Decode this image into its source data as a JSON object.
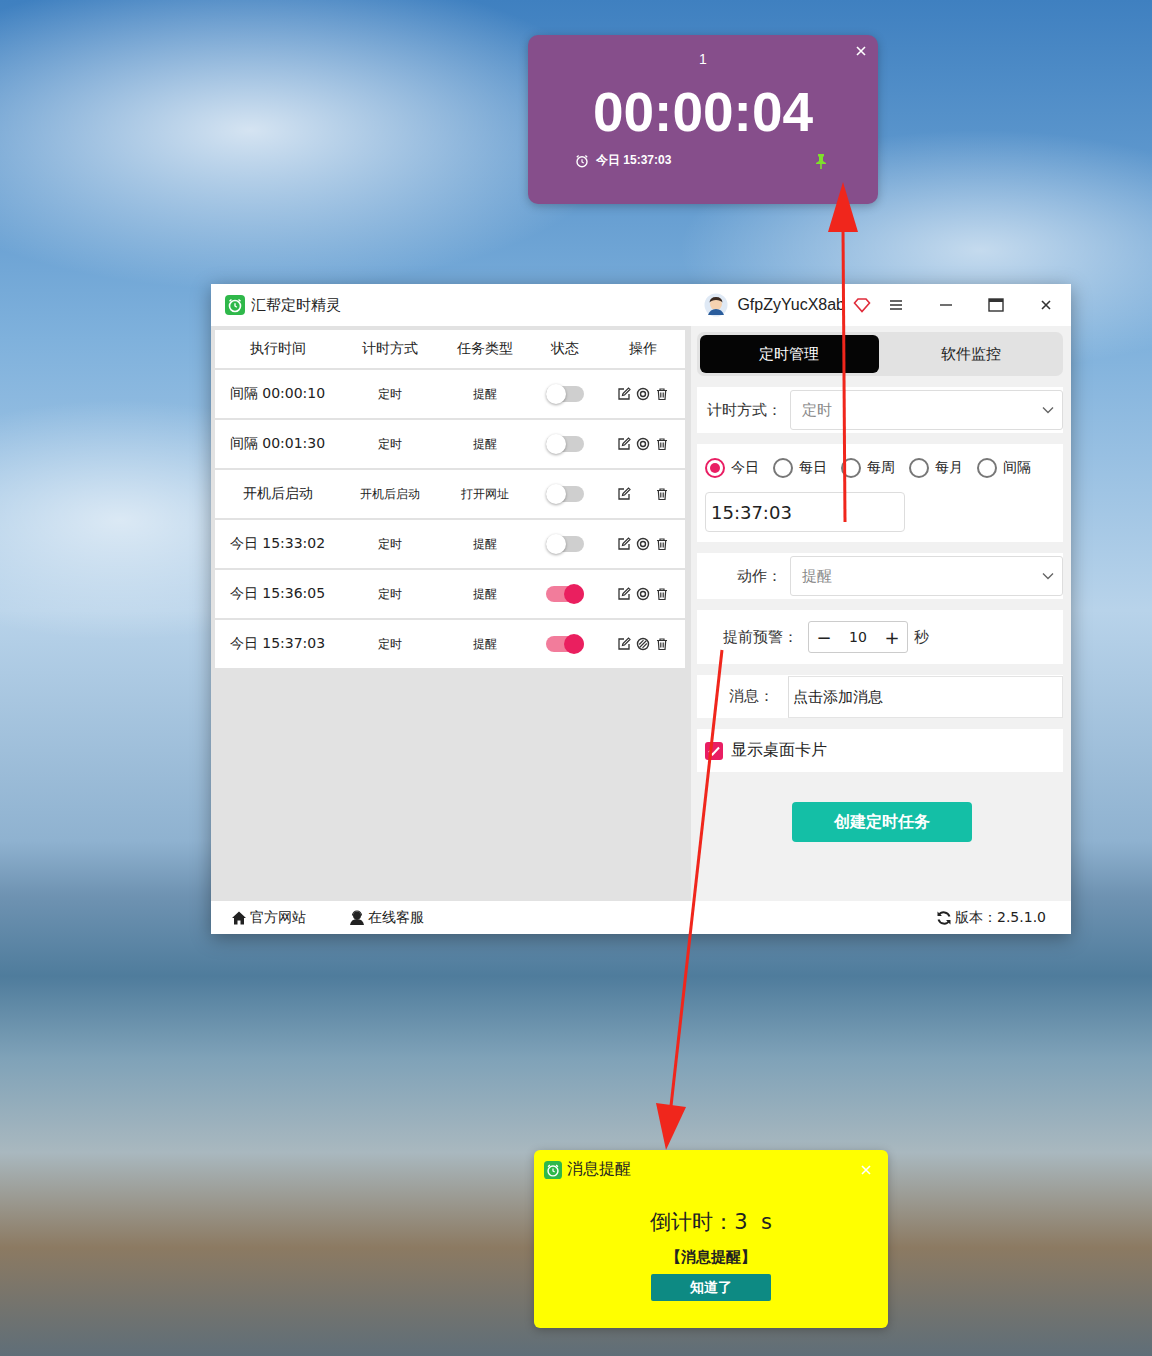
{
  "desktop_card": {
    "index": "1",
    "countdown": "00:00:04",
    "schedule": "今日 15:37:03",
    "pinned": true
  },
  "window": {
    "title": "汇帮定时精灵",
    "user": "GfpZyYucX8ab"
  },
  "table": {
    "columns": [
      "执行时间",
      "计时方式",
      "任务类型",
      "状态",
      "操作"
    ],
    "rows": [
      {
        "time": "间隔 00:00:10",
        "mode": "定时",
        "type": "提醒",
        "on": false,
        "has_preview": true,
        "preview_on": false
      },
      {
        "time": "间隔 00:01:30",
        "mode": "定时",
        "type": "提醒",
        "on": false,
        "has_preview": true,
        "preview_on": false
      },
      {
        "time": "开机后启动",
        "mode": "开机后启动",
        "type": "打开网址",
        "on": false,
        "has_preview": false,
        "preview_on": false
      },
      {
        "time": "今日 15:33:02",
        "mode": "定时",
        "type": "提醒",
        "on": false,
        "has_preview": true,
        "preview_on": false
      },
      {
        "time": "今日 15:36:05",
        "mode": "定时",
        "type": "提醒",
        "on": true,
        "has_preview": true,
        "preview_on": false
      },
      {
        "time": "今日 15:37:03",
        "mode": "定时",
        "type": "提醒",
        "on": true,
        "has_preview": true,
        "preview_on": true
      }
    ]
  },
  "form": {
    "tabs": [
      {
        "label": "定时管理",
        "selected": true
      },
      {
        "label": "软件监控",
        "selected": false
      }
    ],
    "mode_label": "计时方式：",
    "mode_value": "定时",
    "repeat": [
      {
        "label": "今日",
        "selected": true
      },
      {
        "label": "每日",
        "selected": false
      },
      {
        "label": "每周",
        "selected": false
      },
      {
        "label": "每月",
        "selected": false
      },
      {
        "label": "间隔",
        "selected": false
      }
    ],
    "time": "15:37:03",
    "action_label": "动作：",
    "action_value": "提醒",
    "warn_label": "提前预警：",
    "warn_minus": "−",
    "warn_value": "10",
    "warn_plus": "+",
    "warn_unit": "秒",
    "message_label": "消息：",
    "message_placeholder": "点击添加消息",
    "card_label": "显示桌面卡片",
    "card_checked": true,
    "submit": "创建定时任务"
  },
  "status_bar": {
    "links": [
      "官方网站",
      "在线客服"
    ],
    "version": "版本：2.5.1.0"
  },
  "popup": {
    "title": "消息提醒",
    "countdown": "倒计时：3  s",
    "message": "【消息提醒】",
    "button": "知道了"
  }
}
